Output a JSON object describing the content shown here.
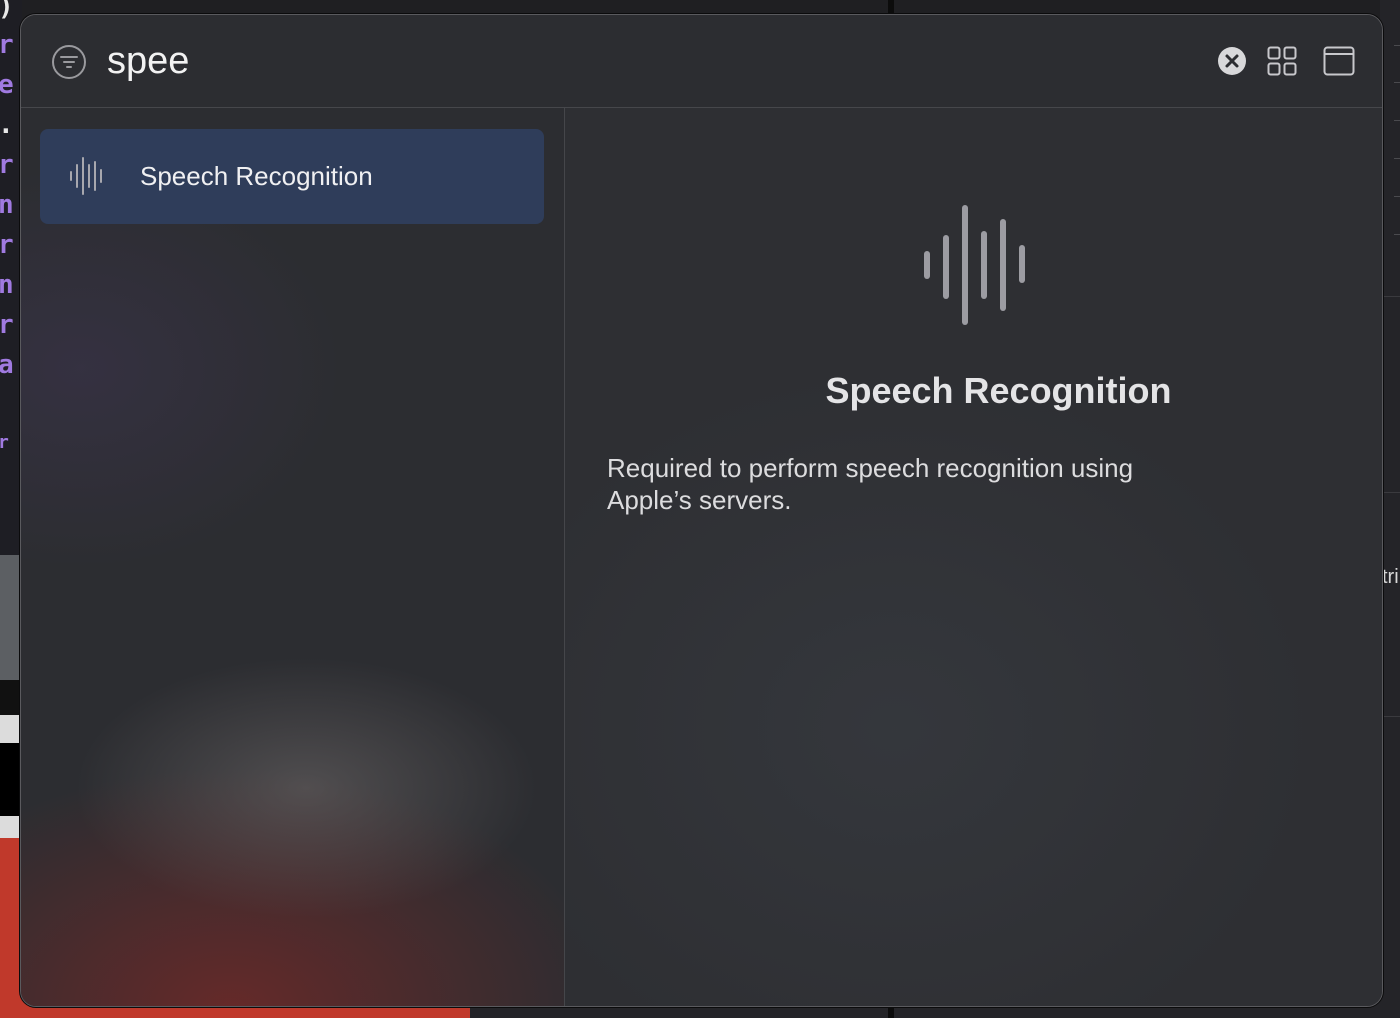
{
  "search": {
    "value": "spee",
    "filter_icon": "filter-icon",
    "clear_icon": "clear-icon",
    "grid_view_icon": "grid-view-icon",
    "window_icon": "window-icon"
  },
  "results": [
    {
      "label": "Speech Recognition",
      "icon": "waveform-icon",
      "selected": true
    }
  ],
  "detail": {
    "icon": "waveform-icon",
    "title": "Speech Recognition",
    "description": "Required to perform speech recognition using Apple’s servers."
  },
  "colors": {
    "selection": "#2f3d5a",
    "window_bg": "#2d2e32",
    "text": "#f0f0f2"
  }
}
